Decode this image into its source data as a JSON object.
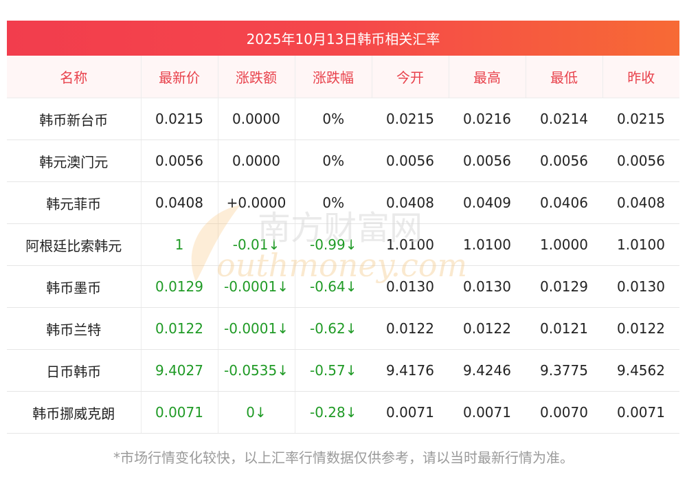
{
  "title": "2025年10月13日韩币相关汇率",
  "headers": [
    "名称",
    "最新价",
    "涨跌额",
    "涨跌幅",
    "今开",
    "最高",
    "最低",
    "昨收"
  ],
  "rows": [
    [
      "韩币新台币",
      "0.0215",
      "0.0000",
      "0%",
      "0.0215",
      "0.0216",
      "0.0214",
      "0.0215"
    ],
    [
      "韩元澳门元",
      "0.0056",
      "0.0000",
      "0%",
      "0.0056",
      "0.0056",
      "0.0056",
      "0.0056"
    ],
    [
      "韩元菲币",
      "0.0408",
      "+0.0000",
      "0%",
      "0.0408",
      "0.0409",
      "0.0406",
      "0.0408"
    ],
    [
      "阿根廷比索韩元",
      "1",
      "-0.01↓",
      "-0.99↓",
      "1.0100",
      "1.0100",
      "1.0000",
      "1.0100"
    ],
    [
      "韩币墨币",
      "0.0129",
      "-0.0001↓",
      "-0.64↓",
      "0.0130",
      "0.0130",
      "0.0129",
      "0.0130"
    ],
    [
      "韩币兰特",
      "0.0122",
      "-0.0001↓",
      "-0.62↓",
      "0.0122",
      "0.0122",
      "0.0121",
      "0.0122"
    ],
    [
      "日币韩币",
      "9.4027",
      "-0.0535↓",
      "-0.57↓",
      "9.4176",
      "9.4246",
      "9.3775",
      "9.4562"
    ],
    [
      "韩币挪威克朗",
      "0.0071",
      "0↓",
      "-0.28↓",
      "0.0071",
      "0.0071",
      "0.0070",
      "0.0071"
    ]
  ],
  "down_rows": [
    3,
    4,
    5,
    6,
    7
  ],
  "watermark": {
    "cn": "南方财富网",
    "en": "outhmoney.com"
  },
  "footnote": "*市场行情变化较快，以上汇率行情数据仅供参考，请以当时最新行情为准。",
  "colors": {
    "title_start": "#f23d4d",
    "title_end": "#f76a35",
    "header_text": "#e8424c",
    "down": "#1f9a25"
  }
}
